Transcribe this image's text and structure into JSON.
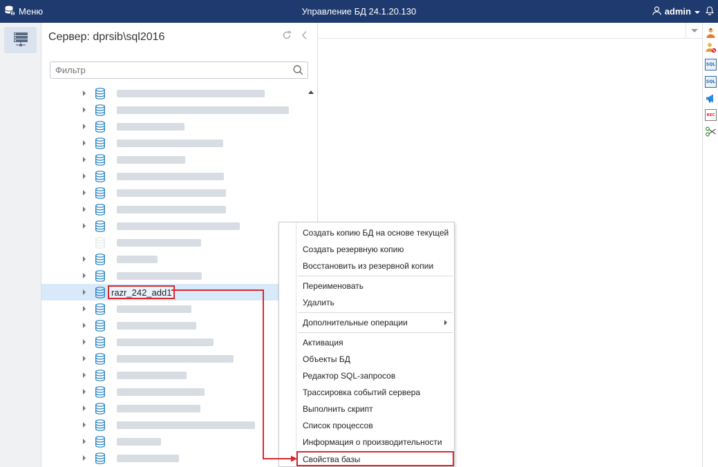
{
  "topbar": {
    "menu_label": "Меню",
    "app_title": "Управление БД 24.1.20.130",
    "user_name": "admin"
  },
  "panel": {
    "title": "Сервер: dprsib\\sql2016",
    "filter_placeholder": "Фильтр"
  },
  "tree": {
    "selected_node_label": "razr_242_add1"
  },
  "context_menu": {
    "items": [
      {
        "label": "Создать копию БД на основе текущей"
      },
      {
        "label": "Создать резервную копию"
      },
      {
        "label": "Восстановить из резервной копии"
      },
      {
        "label": "Переименовать"
      },
      {
        "label": "Удалить"
      },
      {
        "label": "Дополнительные операции",
        "has_submenu": true
      },
      {
        "label": "Активация"
      },
      {
        "label": "Объекты БД"
      },
      {
        "label": "Редактор SQL-запросов"
      },
      {
        "label": "Трассировка событий сервера"
      },
      {
        "label": "Выполнить скрипт"
      },
      {
        "label": "Список процессов"
      },
      {
        "label": "Информация о производительности"
      },
      {
        "label": "Свойства базы",
        "highlighted": true
      }
    ]
  },
  "right_toolbar": {
    "sql_badge_1": "SQL",
    "sql_badge_2": "SQL",
    "rec_badge": "REC"
  },
  "colors": {
    "topbar": "#1f3a6e",
    "accent_blue": "#1f7dbf",
    "highlight_red": "#d9262c",
    "selection": "#d8e9f9"
  }
}
